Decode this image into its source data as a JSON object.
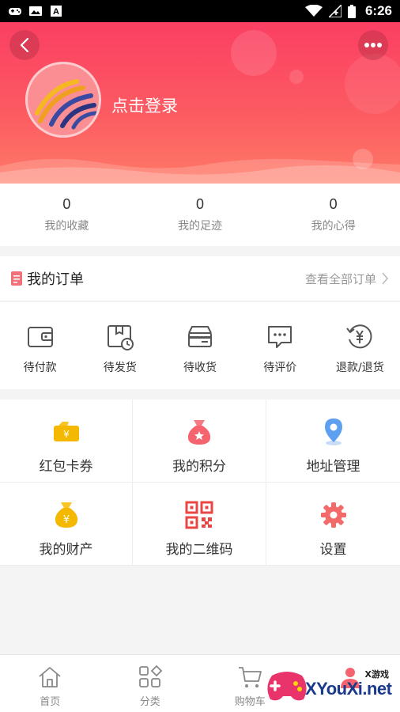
{
  "status_bar": {
    "time": "6:26",
    "left_icons": [
      "gamepad-icon",
      "image-icon",
      "text-a-icon"
    ],
    "right_icons": [
      "wifi-icon",
      "signal-icon",
      "battery-icon"
    ]
  },
  "header": {
    "back_icon": "chevron-left-icon",
    "more_icon": "more-dots-icon",
    "login_text": "点击登录",
    "gradient": [
      "#fb3f63",
      "#fe7a66"
    ]
  },
  "stats": [
    {
      "value": "0",
      "label": "我的收藏"
    },
    {
      "value": "0",
      "label": "我的足迹"
    },
    {
      "value": "0",
      "label": "我的心得"
    }
  ],
  "orders": {
    "title": "我的订单",
    "view_all": "查看全部订单",
    "statuses": [
      {
        "label": "待付款",
        "icon": "wallet-icon"
      },
      {
        "label": "待发货",
        "icon": "package-clock-icon"
      },
      {
        "label": "待收货",
        "icon": "card-box-icon"
      },
      {
        "label": "待评价",
        "icon": "comment-icon"
      },
      {
        "label": "退款/退货",
        "icon": "refund-icon"
      }
    ]
  },
  "menu": [
    {
      "label": "红包卡券",
      "icon": "coupon-icon"
    },
    {
      "label": "我的积分",
      "icon": "points-bag-icon"
    },
    {
      "label": "地址管理",
      "icon": "location-pin-icon"
    },
    {
      "label": "我的财产",
      "icon": "money-bag-icon"
    },
    {
      "label": "我的二维码",
      "icon": "qr-code-icon"
    },
    {
      "label": "设置",
      "icon": "gear-icon"
    }
  ],
  "tabbar": [
    {
      "label": "首页",
      "icon": "home-icon"
    },
    {
      "label": "分类",
      "icon": "category-icon"
    },
    {
      "label": "购物车",
      "icon": "cart-icon"
    },
    {
      "label": "",
      "icon": "user-icon"
    }
  ],
  "watermark": {
    "small": "X游戏",
    "big": "XYouXi.net"
  },
  "colors": {
    "accent": "#fb3f63",
    "coupon": "#f5b800",
    "points": "#f5646e",
    "location": "#5ea0f0",
    "qr": "#e94545",
    "gear": "#f26a6a",
    "icon_gray": "#555555"
  }
}
